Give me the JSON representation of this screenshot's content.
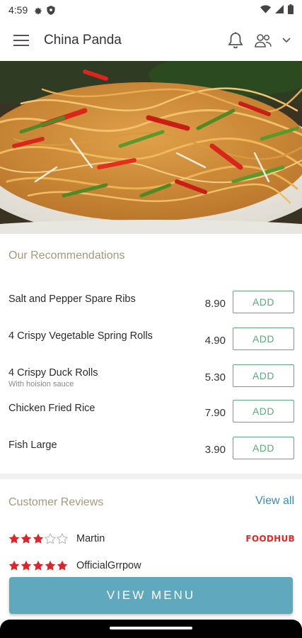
{
  "status_bar": {
    "time": "4:59"
  },
  "app_bar": {
    "title": "China Panda"
  },
  "recommendations": {
    "title": "Our Recommendations",
    "items": [
      {
        "name": "Salt and Pepper Spare Ribs",
        "description": "",
        "price": "8.90",
        "button": "ADD"
      },
      {
        "name": "4 Crispy Vegetable Spring Rolls",
        "description": "",
        "price": "4.90",
        "button": "ADD"
      },
      {
        "name": "4 Crispy Duck Rolls",
        "description": "With hoision sauce",
        "price": "5.30",
        "button": "ADD"
      },
      {
        "name": "Chicken Fried Rice",
        "description": "",
        "price": "7.90",
        "button": "ADD"
      },
      {
        "name": "Fish Large",
        "description": "",
        "price": "3.90",
        "button": "ADD"
      }
    ]
  },
  "reviews": {
    "title": "Customer Reviews",
    "view_all": "View all",
    "items": [
      {
        "name": "Martin",
        "rating": 3,
        "max_rating": 5,
        "source": "FOODHUB"
      },
      {
        "name": "OfficialGrrpow",
        "rating": 5,
        "max_rating": 5,
        "source": ""
      }
    ]
  },
  "cta": {
    "label": "VIEW MENU"
  },
  "colors": {
    "accent_green": "#5ca97a",
    "star_red": "#d9262b",
    "cta_blue": "#5fa8be",
    "link_blue": "#3f8eb0",
    "section_title": "#a39a7e"
  }
}
